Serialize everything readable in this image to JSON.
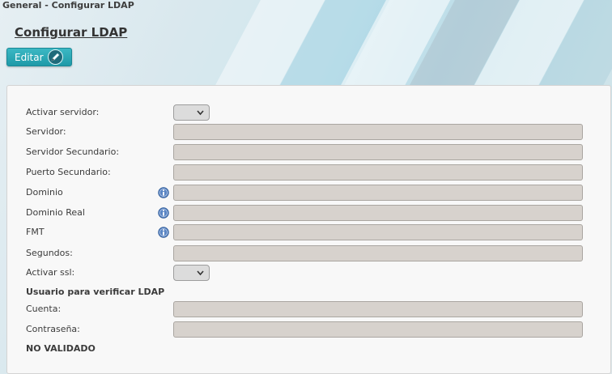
{
  "breadcrumb": "General - Configurar LDAP",
  "page_title": "Configurar LDAP",
  "edit_button_label": "Editar",
  "form": {
    "activar_servidor": "Activar servidor:",
    "servidor": "Servidor:",
    "servidor_secundario": "Servidor Secundario:",
    "puerto_secundario": "Puerto Secundario:",
    "dominio": "Dominio",
    "dominio_real": "Dominio Real",
    "fmt": "FMT",
    "segundos": "Segundos:",
    "activar_ssl": "Activar ssl:",
    "usuario_heading": "Usuario para verificar LDAP",
    "cuenta": "Cuenta:",
    "contrasena": "Contraseña:",
    "status": "NO VALIDADO"
  },
  "colors": {
    "accent": "#1f9aa8",
    "field_bg": "#d7d2cd",
    "info_icon": "#5b86c4"
  },
  "icons": {
    "edit": "pencil-icon",
    "info": "info-icon",
    "dropdown": "chevron-down-icon"
  }
}
